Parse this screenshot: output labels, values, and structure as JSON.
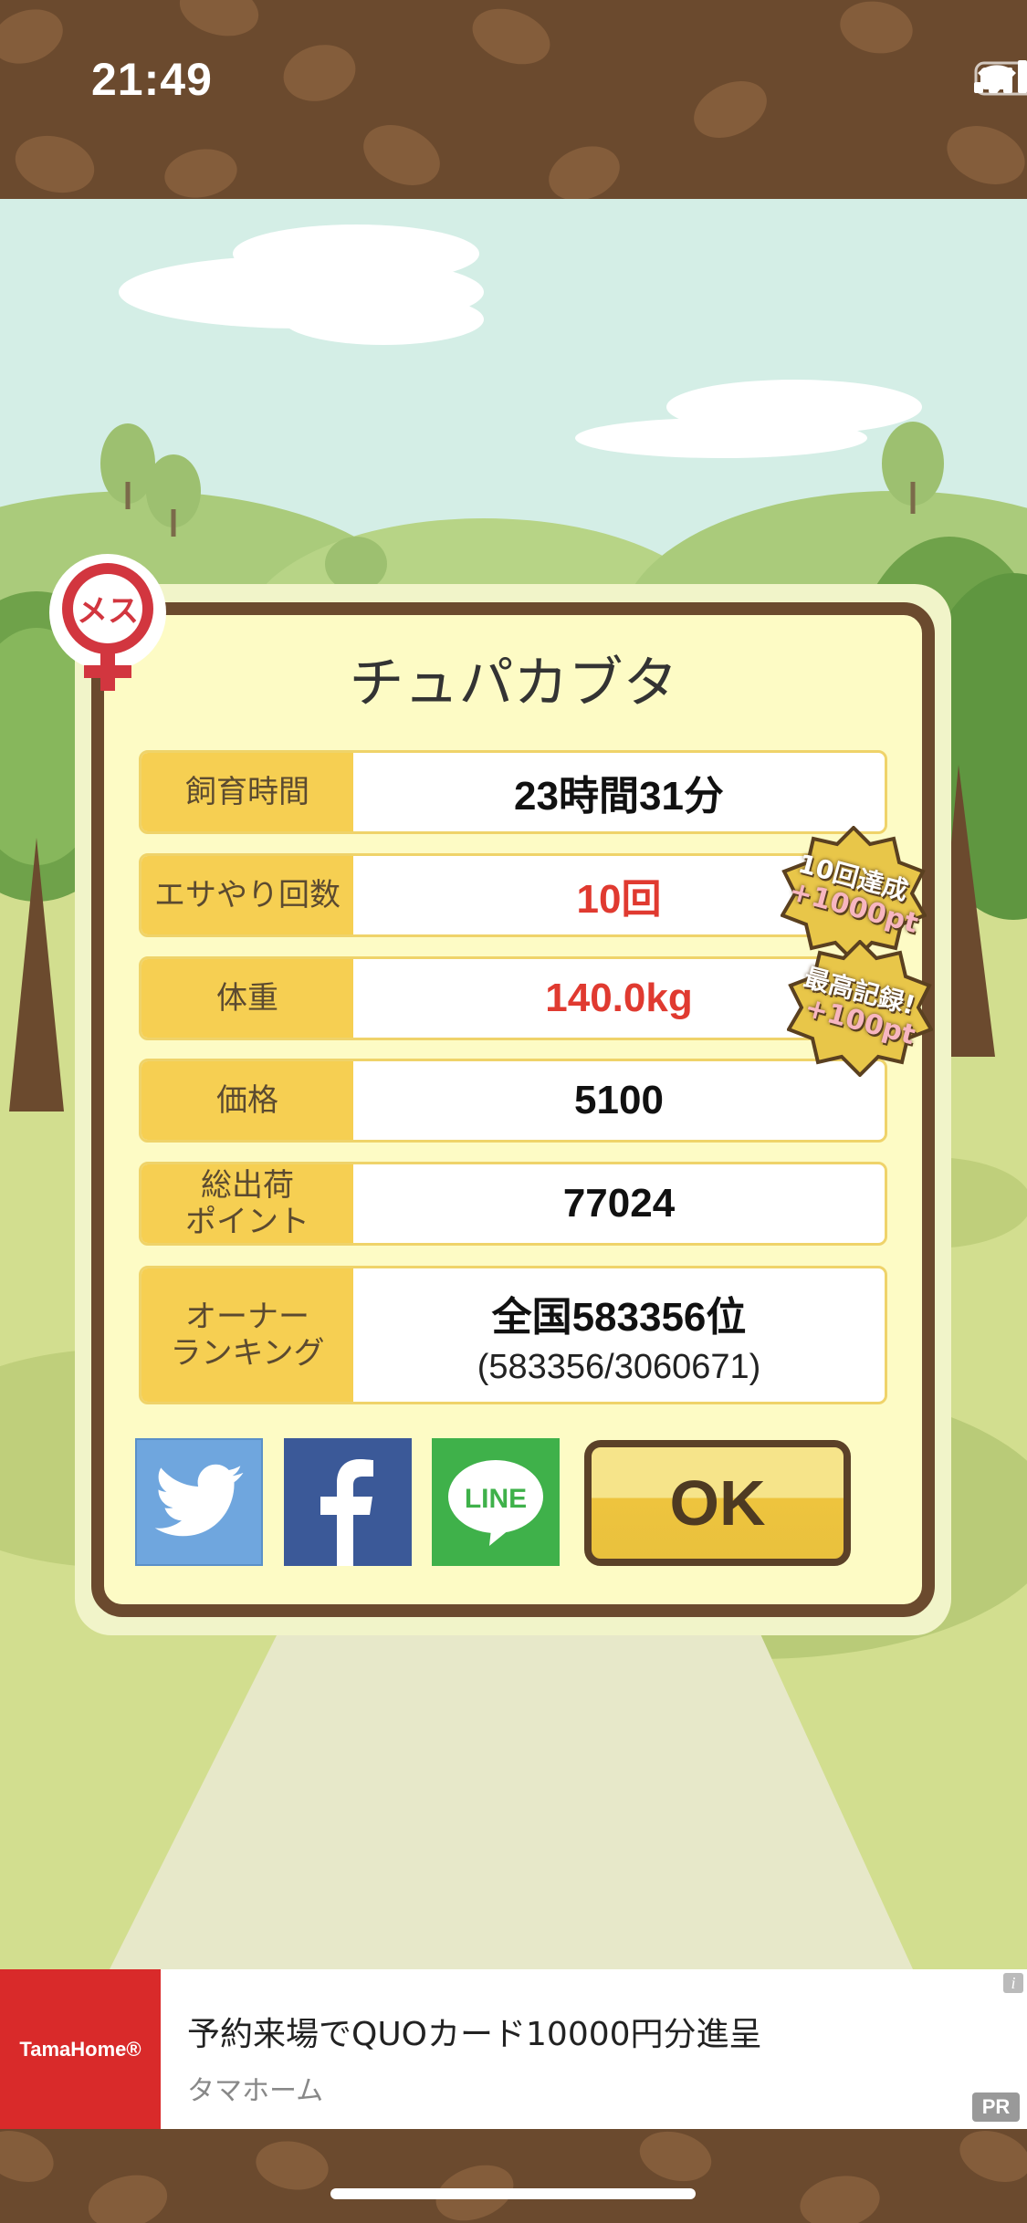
{
  "status_bar": {
    "time": "21:49"
  },
  "dialog": {
    "pig_name": "チュパカブタ",
    "stats": [
      {
        "label": "飼育時間",
        "value": "23時間31分"
      },
      {
        "label": "エサやり回数",
        "value": "10回"
      },
      {
        "label": "体重",
        "value": "140.0kg"
      },
      {
        "label": "価格",
        "value": "5100"
      },
      {
        "label": "総出荷\nポイント",
        "value": "77024"
      },
      {
        "label": "オーナー\nランキング",
        "value": "全国583356位",
        "sub_value": "(583356/3060671)"
      }
    ],
    "achievements": [
      {
        "line1": "10回達成",
        "line2": "+1000pt"
      },
      {
        "line1": "最高記録!",
        "line2": "+100pt"
      }
    ],
    "share": {
      "line_label": "LINE"
    },
    "ok_label": "OK",
    "female_badge_text": "メス"
  },
  "ad": {
    "logo_text": "TamaHome®",
    "title": "予約来場でQUOカード10000円分進呈",
    "source": "タマホーム",
    "info_glyph": "i",
    "pr_badge": "PR"
  },
  "colors": {
    "brown": "#6b4a2e",
    "dialog_bg": "#fdfbc5",
    "label_bg": "#f6cf52",
    "highlight_red": "#e03a30",
    "twitter": "#6fa6de",
    "facebook": "#3b5998",
    "line": "#3fb14a"
  }
}
